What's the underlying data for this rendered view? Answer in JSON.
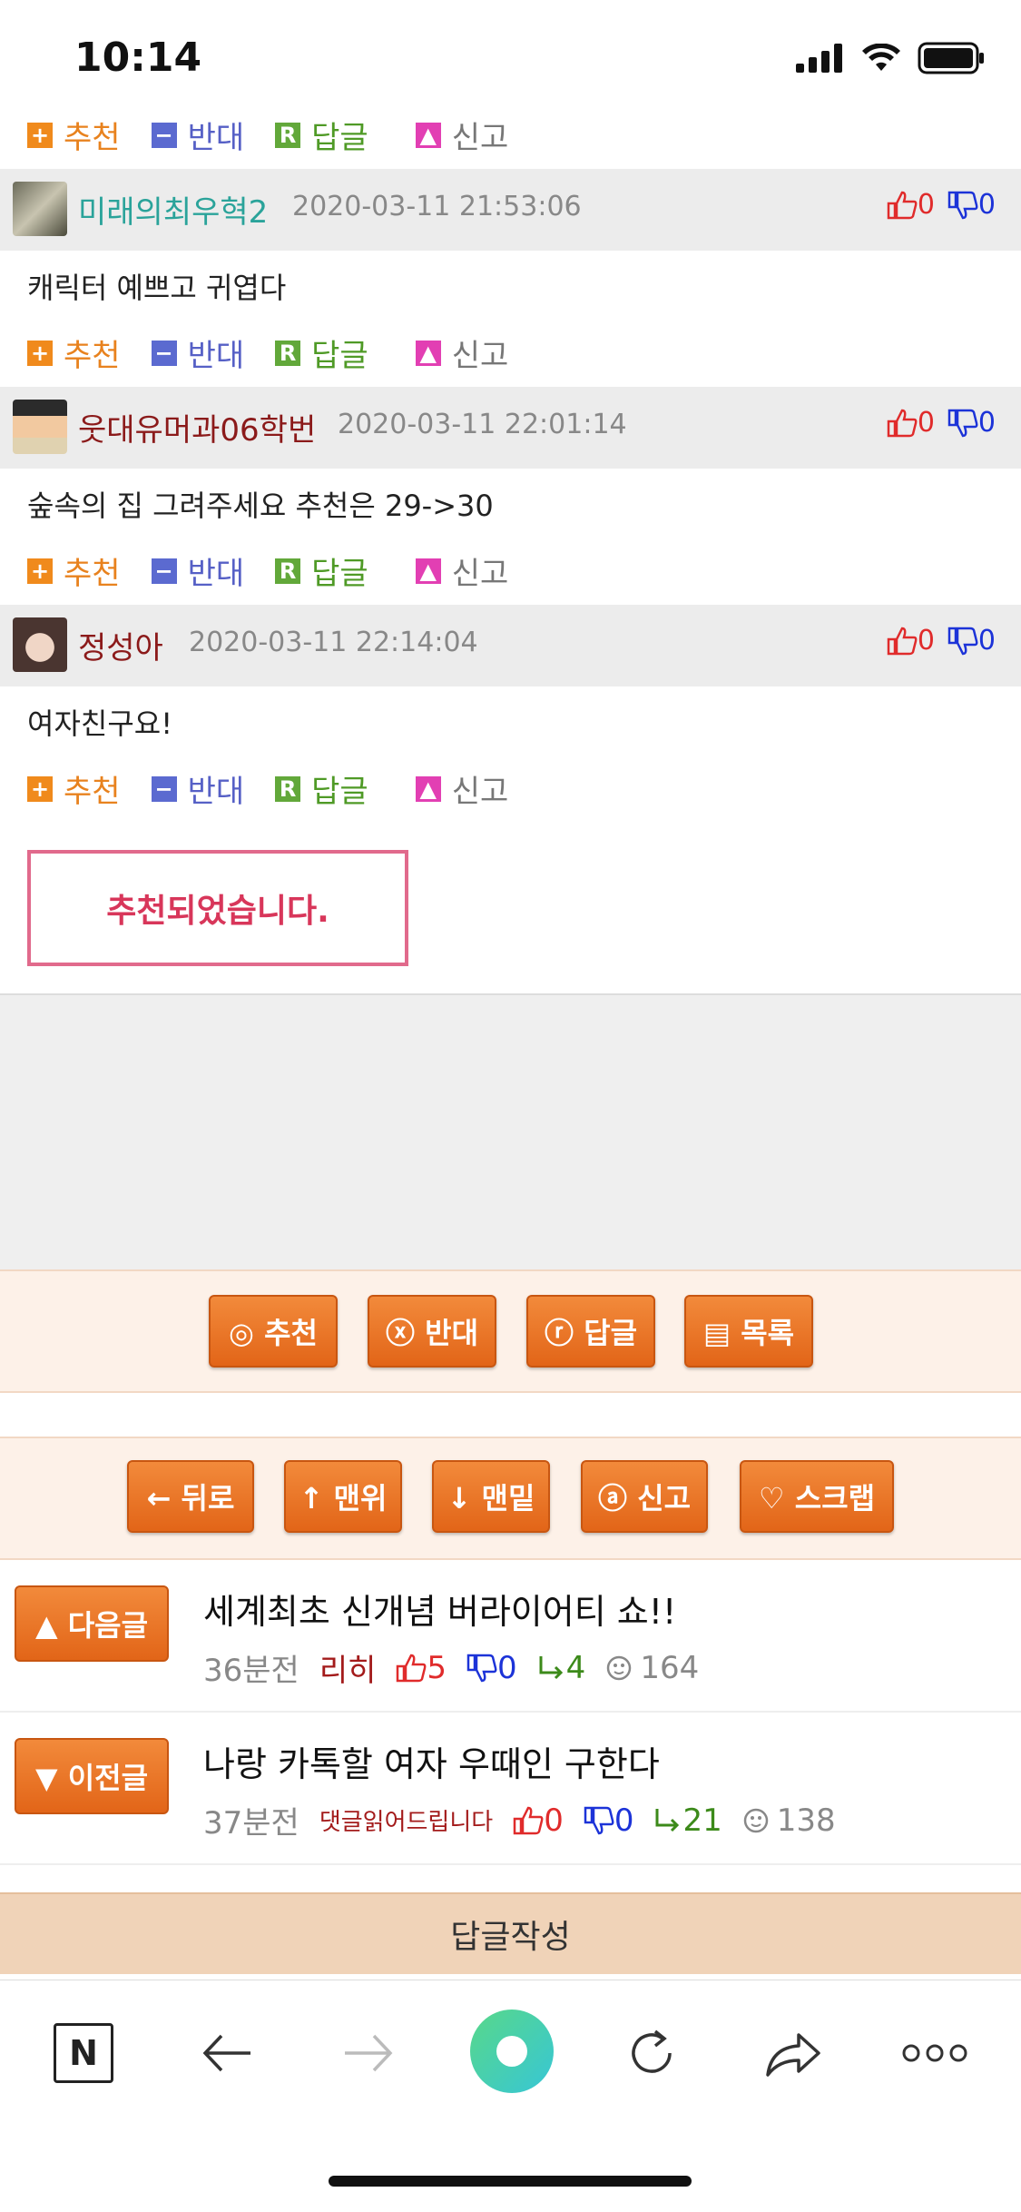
{
  "status": {
    "time": "10:14"
  },
  "action_labels": {
    "recommend": "추천",
    "oppose": "반대",
    "reply": "답글",
    "report": "신고"
  },
  "comments": [
    {
      "author": "미래의최우혁2",
      "date": "2020-03-11 21:53:06",
      "up": "0",
      "down": "0",
      "text": "캐릭터 예쁘고 귀엽다",
      "author_color": "#2aa39a"
    },
    {
      "author": "웃대유머과06학번",
      "date": "2020-03-11 22:01:14",
      "up": "0",
      "down": "0",
      "text": "숲속의 집 그려주세요 추천은 29->30",
      "author_color": "#8b1a1a"
    },
    {
      "author": "정성아",
      "date": "2020-03-11 22:14:04",
      "up": "0",
      "down": "0",
      "text": "여자친구요!",
      "author_color": "#8b1a1a"
    }
  ],
  "toast": "추천되었습니다.",
  "post_buttons": {
    "recommend": "◎ 추천",
    "oppose": "ⓧ 반대",
    "reply": "ⓡ 답글",
    "list": "▤ 목록"
  },
  "nav_buttons": {
    "back": "← 뒤로",
    "top": "↑ 맨위",
    "bottom": "↓ 맨밑",
    "report": "ⓐ 신고",
    "scrap": "♡ 스크랩"
  },
  "next_post": {
    "button": "▲ 다음글",
    "title": "세계최초 신개념 버라이어티 쇼!!",
    "time": "36분전",
    "author": "리히",
    "up": "5",
    "down": "0",
    "replies": "4",
    "views": "164"
  },
  "prev_post": {
    "button": "▼ 이전글",
    "title": "나랑 카톡할 여자 우때인 구한다",
    "time": "37분전",
    "author": "댓글읽어드립니다",
    "up": "0",
    "down": "0",
    "replies": "21",
    "views": "138"
  },
  "reply_write": "답글작성",
  "browser": {
    "n_label": "N"
  }
}
